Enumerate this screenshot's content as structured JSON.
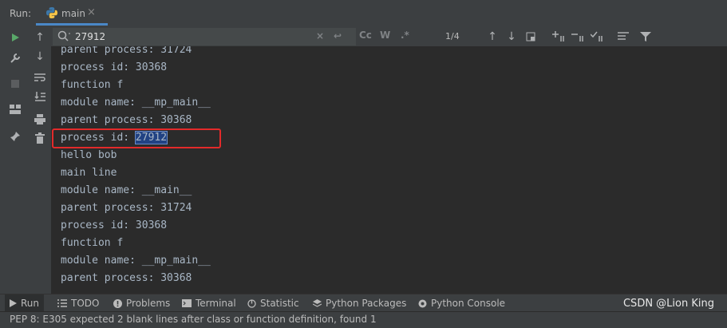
{
  "run_panel": {
    "label": "Run:",
    "tab_name": "main"
  },
  "search": {
    "query": "27912",
    "match_count": "1/4",
    "case_label": "Cc",
    "word_label": "W",
    "regex_label": ".*"
  },
  "console": {
    "lines": [
      "parent process: 31724",
      "process id: 30368",
      "function f",
      "module name: __mp_main__",
      "parent process: 30368",
      "process id: ",
      "hello bob",
      "main line",
      "module name: __main__",
      "parent process: 31724",
      "process id: 30368",
      "function f",
      "module name: __mp_main__",
      "parent process: 30368"
    ],
    "highlight_text": "27912"
  },
  "bottom_tabs": {
    "run": "Run",
    "todo": "TODO",
    "problems": "Problems",
    "terminal": "Terminal",
    "statistic": "Statistic",
    "python_packages": "Python Packages",
    "python_console": "Python Console"
  },
  "watermark": "CSDN @Lion King",
  "status": {
    "message": "PEP 8: E305 expected 2 blank lines after class or function definition, found 1"
  },
  "colors": {
    "background": "#2b2b2b",
    "panel": "#3c3f41",
    "accent": "#4a88c7",
    "highlight": "#214283",
    "red_box": "#e32a2a",
    "run_green": "#59a869"
  }
}
